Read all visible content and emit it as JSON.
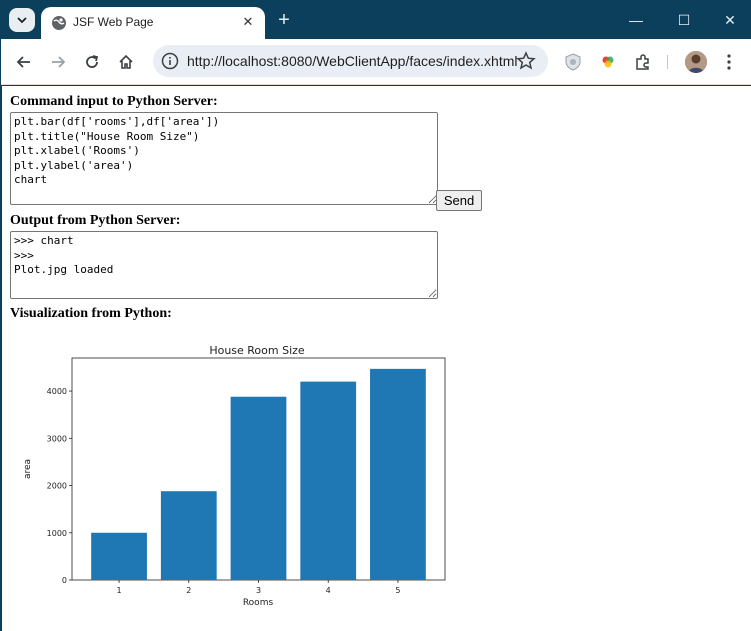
{
  "browser": {
    "tab_title": "JSF Web Page",
    "url_host": "http://localhost",
    "url_rest": ":8080/WebClientApp/faces/index.xhtml",
    "accent": "#0b3f5c"
  },
  "page": {
    "command_label": "Command input to Python Server:",
    "command_value": "plt.bar(df['rooms'],df['area'])\nplt.title(\"House Room Size\")\nplt.xlabel('Rooms')\nplt.ylabel('area')\nchart",
    "send_label": "Send",
    "output_label": "Output from Python Server:",
    "output_value": ">>> chart\n>>>\nPlot.jpg loaded",
    "viz_label": "Visualization from Python:"
  },
  "chart_data": {
    "type": "bar",
    "title": "House Room Size",
    "xlabel": "Rooms",
    "ylabel": "area",
    "categories": [
      "1",
      "2",
      "3",
      "4",
      "5"
    ],
    "values": [
      1000,
      1880,
      3880,
      4200,
      4470
    ],
    "ylim": [
      0,
      4700
    ],
    "yticks": [
      "0",
      "1000",
      "2000",
      "3000",
      "4000"
    ],
    "bar_color": "#1f77b4",
    "grid": false
  }
}
